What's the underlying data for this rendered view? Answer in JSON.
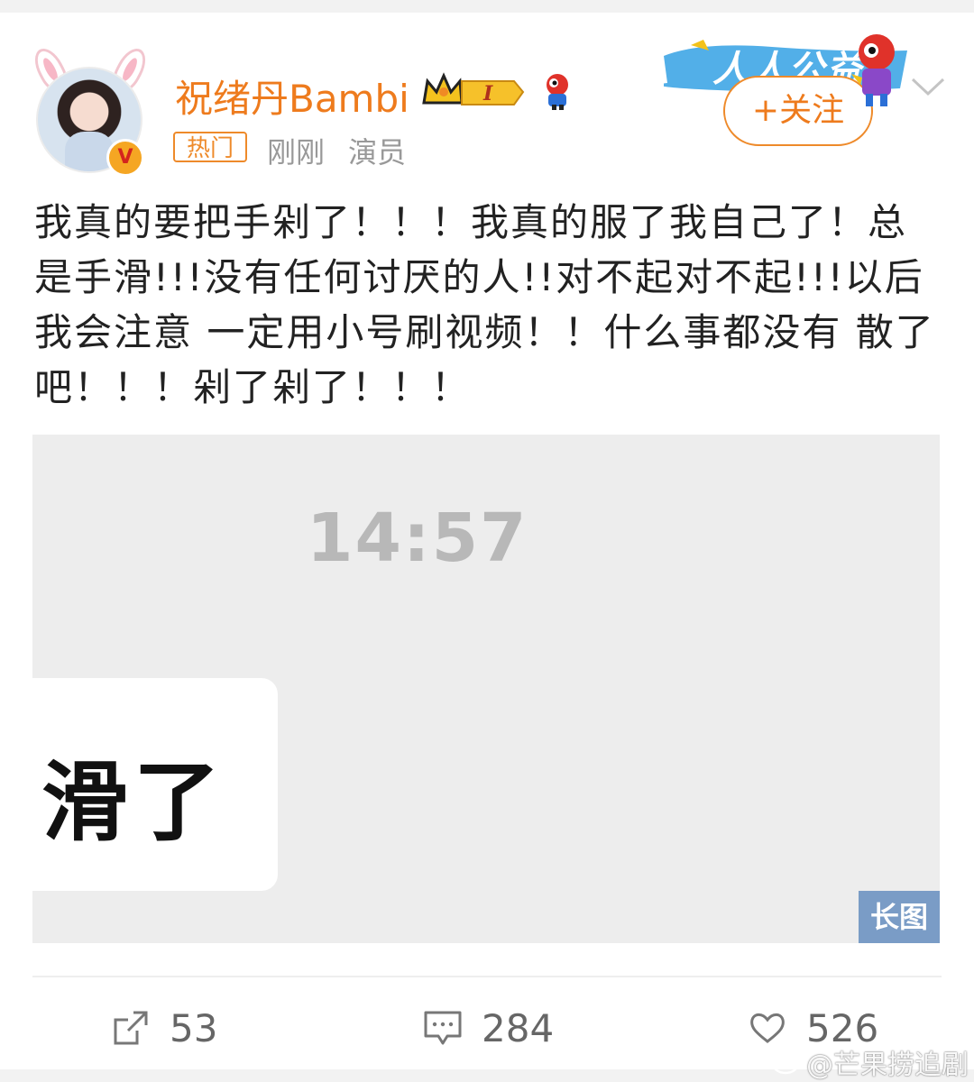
{
  "user": {
    "name": "祝绪丹Bambi",
    "verified_icon": "v-badge-icon",
    "crown_level": "I",
    "hot_tag": "热门",
    "time": "刚刚",
    "source": "演员"
  },
  "header": {
    "promo_banner": "人人公益",
    "follow_label": "+关注",
    "menu_icon": "chevron-down-icon"
  },
  "post": {
    "text": "我真的要把手剁了！！！我真的服了我自己了！总是手滑!!!没有任何讨厌的人!!对不起对不起!!!以后我会注意 一定用小号刷视频！！什么事都没有 散了吧！！！剁了剁了！！！"
  },
  "image": {
    "time": "14:57",
    "bubble_text": "滑了",
    "long_badge": "长图"
  },
  "actions": {
    "share_count": "53",
    "comment_count": "284",
    "like_count": "526"
  },
  "watermark": {
    "text": "@芒果捞追剧"
  },
  "colors": {
    "accent": "#ee7b1d",
    "badge_blue": "#7a9cc6",
    "text": "#222222",
    "muted": "#999999"
  }
}
